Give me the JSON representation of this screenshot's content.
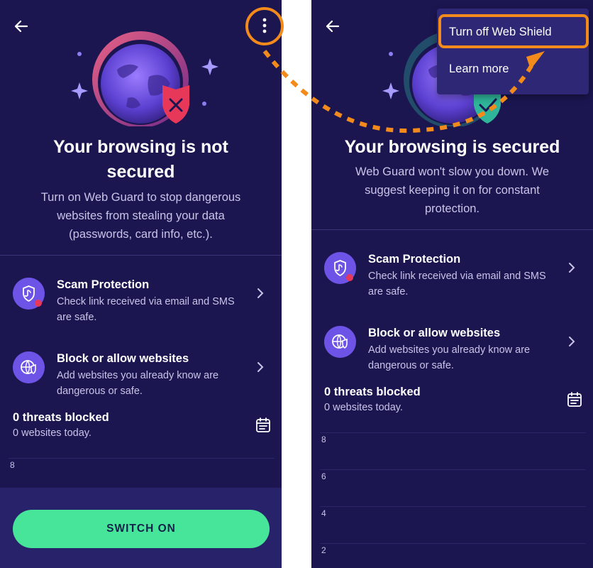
{
  "left": {
    "title_line1": "Your browsing is not",
    "title_line2": "secured",
    "subtitle_line1": "Turn on Web Guard to stop dangerous",
    "subtitle_line2": "websites from stealing your data",
    "subtitle_line3": "(passwords, card info, etc.).",
    "shield_status": "not-secured",
    "rows": [
      {
        "title": "Scam Protection",
        "desc": "Check link received via email and SMS are safe.",
        "icon": "scam-protection-icon",
        "alert_dot": true
      },
      {
        "title": "Block or allow websites",
        "desc": "Add websites you already know are dangerous or safe.",
        "icon": "globe-shield-icon",
        "alert_dot": false
      }
    ],
    "threats_title": "0 threats blocked",
    "threats_sub": "0 websites today.",
    "chart_ticks": [
      "8"
    ],
    "switch_label": "SWITCH ON"
  },
  "right": {
    "title": "Your browsing is secured",
    "subtitle_line1": "Web Guard won't slow you down. We",
    "subtitle_line2": "suggest keeping it on for constant",
    "subtitle_line3": "protection.",
    "shield_status": "secured",
    "rows": [
      {
        "title": "Scam Protection",
        "desc": "Check link received via email and SMS are safe.",
        "icon": "scam-protection-icon",
        "alert_dot": true
      },
      {
        "title": "Block or allow websites",
        "desc": "Add websites you already know are dangerous or safe.",
        "icon": "globe-shield-icon",
        "alert_dot": false
      }
    ],
    "threats_title": "0 threats blocked",
    "threats_sub": "0 websites today.",
    "chart_ticks": [
      "8",
      "6",
      "4",
      "2"
    ],
    "menu": [
      {
        "label": "Turn off Web Shield",
        "highlighted": true
      },
      {
        "label": "Learn more",
        "highlighted": false
      }
    ]
  },
  "colors": {
    "background": "#1b1650",
    "accent_purple": "#6e54e6",
    "switch_green": "#47e59a",
    "highlight_orange": "#f28a1c",
    "alert_red": "#e8385a",
    "secured_teal": "#2fb59a"
  }
}
